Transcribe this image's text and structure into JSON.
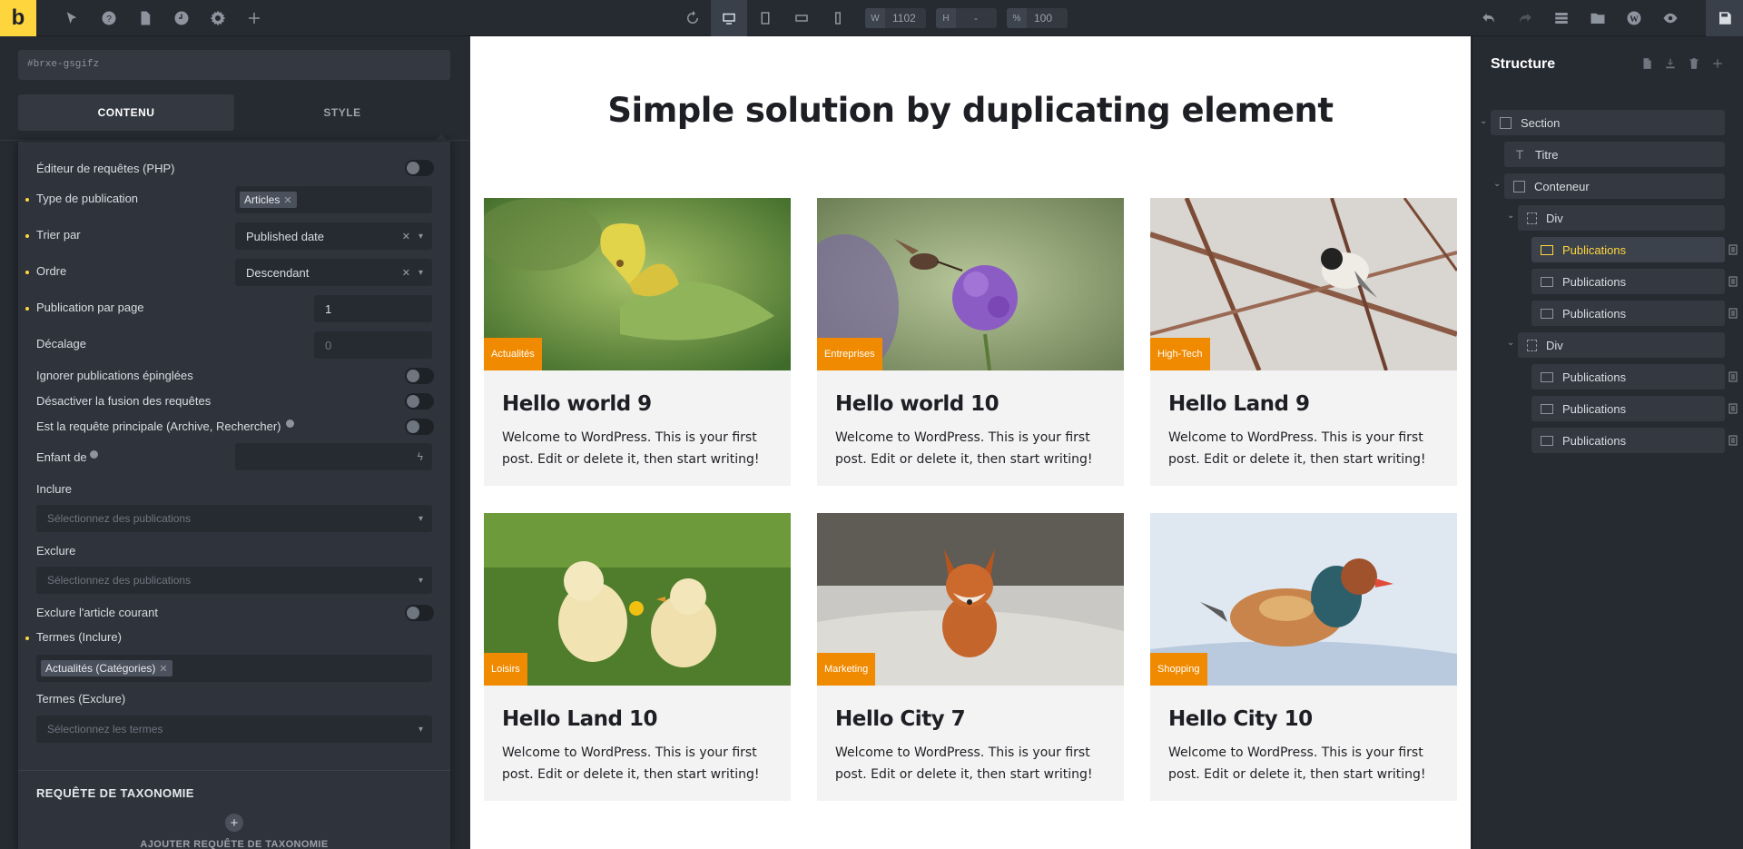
{
  "toolbar": {
    "logo": "b",
    "width_key": "W",
    "width_value": "1102",
    "height_key": "H",
    "height_value": "-",
    "zoom_key": "%",
    "zoom_value": "100"
  },
  "sidebar": {
    "element_id": "#brxe-gsgifz",
    "tabs": [
      "CONTENU",
      "STYLE"
    ],
    "query": {
      "php_editor_label": "Éditeur de requêtes (PHP)",
      "post_type_label": "Type de publication",
      "post_type_chip": "Articles",
      "order_by_label": "Trier par",
      "order_by_value": "Published date",
      "order_label": "Ordre",
      "order_value": "Descendant",
      "per_page_label": "Publication par page",
      "per_page_value": "1",
      "offset_label": "Décalage",
      "offset_placeholder": "0",
      "ignore_sticky_label": "Ignorer publications épinglées",
      "disable_merge_label": "Désactiver la fusion des requêtes",
      "main_query_label": "Est la requête principale (Archive, Rechercher)",
      "child_of_label": "Enfant de",
      "include_label": "Inclure",
      "include_placeholder": "Sélectionnez des publications",
      "exclude_label": "Exclure",
      "exclude_placeholder": "Sélectionnez des publications",
      "exclude_current_label": "Exclure l'article courant",
      "terms_include_label": "Termes (Inclure)",
      "terms_include_chip": "Actualités (Catégories)",
      "terms_exclude_label": "Termes (Exclure)",
      "terms_exclude_placeholder": "Sélectionnez les termes",
      "taxonomy_section": "REQUÊTE DE TAXONOMIE",
      "add_taxonomy": "AJOUTER REQUÊTE DE TAXONOMIE"
    }
  },
  "canvas": {
    "title": "Simple solution by duplicating element",
    "posts": [
      {
        "title": "Hello world 9",
        "category": "Actualités",
        "excerpt": "Welcome to WordPress. This is your first post. Edit or delete it, then start writing!",
        "image": "butterfly"
      },
      {
        "title": "Hello world 10",
        "category": "Entreprises",
        "excerpt": "Welcome to WordPress. This is your first post. Edit or delete it, then start writing!",
        "image": "hummingbird-moth"
      },
      {
        "title": "Hello Land 9",
        "category": "High-Tech",
        "excerpt": "Welcome to WordPress. This is your first post. Edit or delete it, then start writing!",
        "image": "chickadee"
      },
      {
        "title": "Hello Land 10",
        "category": "Loisirs",
        "excerpt": "Welcome to WordPress. This is your first post. Edit or delete it, then start writing!",
        "image": "chicks"
      },
      {
        "title": "Hello City 7",
        "category": "Marketing",
        "excerpt": "Welcome to WordPress. This is your first post. Edit or delete it, then start writing!",
        "image": "fox"
      },
      {
        "title": "Hello City 10",
        "category": "Shopping",
        "excerpt": "Welcome to WordPress. This is your first post. Edit or delete it, then start writing!",
        "image": "mandarin-duck"
      }
    ]
  },
  "structure": {
    "title": "Structure",
    "nodes": {
      "section": "Section",
      "titre": "Titre",
      "conteneur": "Conteneur",
      "div1": "Div",
      "pub1": "Publications",
      "pub2": "Publications",
      "pub3": "Publications",
      "div2": "Div",
      "pub4": "Publications",
      "pub5": "Publications",
      "pub6": "Publications"
    }
  },
  "colors": {
    "accent": "#ffd53e",
    "category_badge": "#f08a00",
    "panel_bg": "#262a31"
  }
}
